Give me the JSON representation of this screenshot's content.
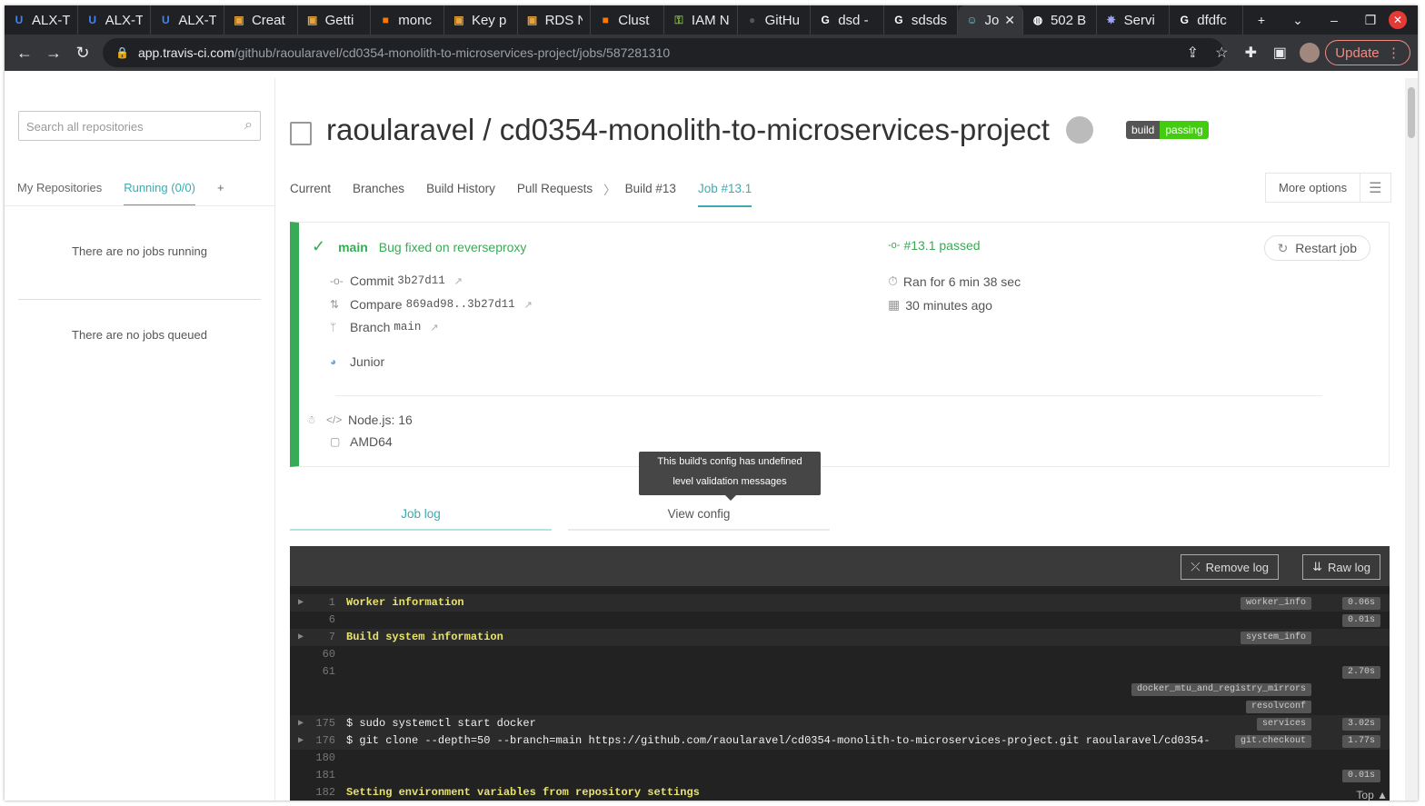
{
  "browser": {
    "tabs": [
      {
        "label": "ALX-T",
        "icon": "U"
      },
      {
        "label": "ALX-T",
        "icon": "U"
      },
      {
        "label": "ALX-T",
        "icon": "U"
      },
      {
        "label": "Creat",
        "icon": "box"
      },
      {
        "label": "Getti",
        "icon": "box"
      },
      {
        "label": "monc",
        "icon": "cube"
      },
      {
        "label": "Key p",
        "icon": "box"
      },
      {
        "label": "RDS N",
        "icon": "box"
      },
      {
        "label": "Clust",
        "icon": "cube"
      },
      {
        "label": "IAM N",
        "icon": "key"
      },
      {
        "label": "GitHu",
        "icon": "github"
      },
      {
        "label": "dsd -",
        "icon": "G"
      },
      {
        "label": "sdsds",
        "icon": "G"
      },
      {
        "label": "Jo",
        "icon": "travis"
      },
      {
        "label": "502 B",
        "icon": "globe"
      },
      {
        "label": "Servi",
        "icon": "helm"
      },
      {
        "label": "dfdfc",
        "icon": "G"
      }
    ],
    "url_host": "app.travis-ci.com",
    "url_path": "/github/raoularavel/cd0354-monolith-to-microservices-project/jobs/587281310",
    "update_label": "Update"
  },
  "sidebar": {
    "search_placeholder": "Search all repositories",
    "tabs": [
      "My Repositories",
      "Running (0/0)",
      "+"
    ],
    "no_running": "There are no jobs running",
    "no_queued": "There are no jobs queued"
  },
  "repo": {
    "name": "raoularavel / cd0354-monolith-to-microservices-project",
    "badge_left": "build",
    "badge_right": "passing"
  },
  "nav": {
    "items": [
      "Current",
      "Branches",
      "Build History",
      "Pull Requests",
      "Build #13",
      "Job #13.1"
    ],
    "more_options": "More options"
  },
  "job": {
    "branch": "main",
    "message": "Bug fixed on reverseproxy",
    "status": "#13.1 passed",
    "commit_label": "Commit",
    "commit_hash": "3b27d11",
    "compare_label": "Compare",
    "compare_range": "869ad98..3b27d11",
    "branch_label": "Branch",
    "branch_value": "main",
    "author": "Junior",
    "ran_for": "Ran for 6 min 38 sec",
    "ago": "30 minutes ago",
    "restart": "Restart job",
    "language": "Node.js: 16",
    "arch": "AMD64",
    "status_color": "#39aa56"
  },
  "tooltip": {
    "line1": "This build's config has undefined",
    "line2": "level validation messages"
  },
  "log_tabs": [
    "Job log",
    "View config"
  ],
  "log": {
    "remove_label": "Remove log",
    "raw_label": "Raw log",
    "top_label": "Top",
    "lines": [
      {
        "num": "1",
        "text": "Worker information",
        "fold": "worker_info",
        "dur": "0.06s",
        "arrow": true,
        "yellow": true
      },
      {
        "num": "6",
        "text": "",
        "fold": "",
        "dur": "0.01s",
        "arrow": false,
        "yellow": false
      },
      {
        "num": "7",
        "text": "Build system information",
        "fold": "system_info",
        "dur": "",
        "arrow": true,
        "yellow": true
      },
      {
        "num": "60",
        "text": "",
        "fold": "",
        "dur": "",
        "arrow": false,
        "yellow": false
      },
      {
        "num": "61",
        "text": "",
        "fold": "",
        "dur": "2.70s",
        "arrow": false,
        "yellow": false
      },
      {
        "num": "",
        "text": "",
        "fold": "docker_mtu_and_registry_mirrors",
        "dur": "",
        "arrow": false,
        "yellow": false
      },
      {
        "num": "",
        "text": "",
        "fold": "resolvconf",
        "dur": "",
        "arrow": false,
        "yellow": false
      },
      {
        "num": "175",
        "text": "$ sudo systemctl start docker",
        "fold": "services",
        "dur": "3.02s",
        "arrow": true,
        "yellow": false
      },
      {
        "num": "176",
        "text": "$ git clone --depth=50 --branch=main https://github.com/raoularavel/cd0354-monolith-to-microservices-project.git raoularavel/cd0354-",
        "fold": "git.checkout",
        "dur": "1.77s",
        "arrow": true,
        "yellow": false
      },
      {
        "num": "180",
        "text": "",
        "fold": "",
        "dur": "",
        "arrow": false,
        "yellow": false
      },
      {
        "num": "181",
        "text": "",
        "fold": "",
        "dur": "0.01s",
        "arrow": false,
        "yellow": false
      },
      {
        "num": "182",
        "text": "Setting environment variables from repository settings",
        "fold": "",
        "dur": "",
        "arrow": false,
        "yellow": true
      }
    ]
  }
}
